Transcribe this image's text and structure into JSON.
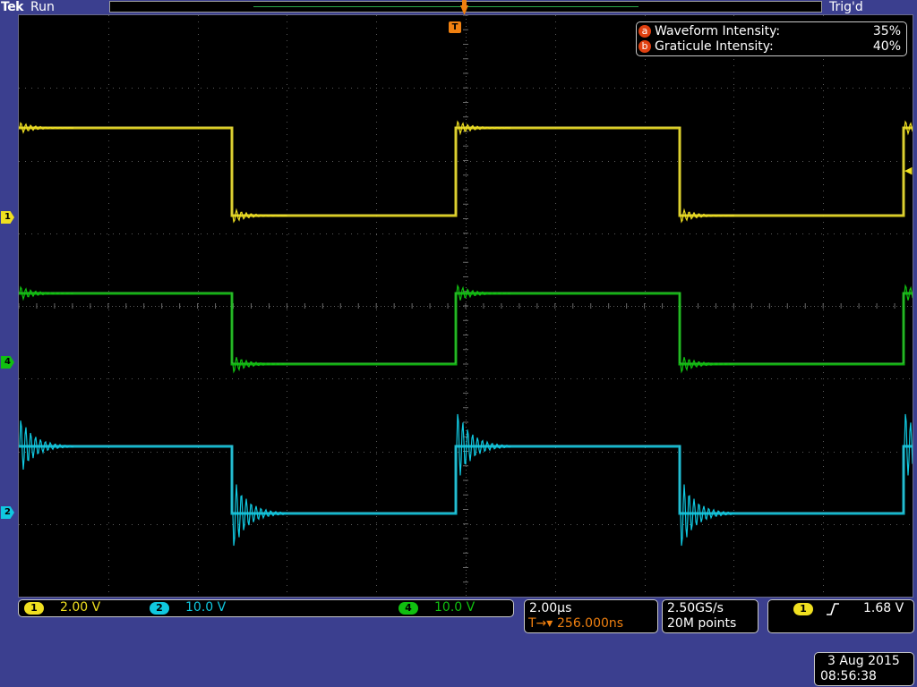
{
  "header": {
    "brand": "Tek",
    "status": "Run",
    "trigger_state": "Trig'd"
  },
  "intensity": {
    "waveform": {
      "key": "a",
      "label": "Waveform Intensity:",
      "value": "35%"
    },
    "graticule": {
      "key": "b",
      "label": "Graticule Intensity:",
      "value": "40%"
    }
  },
  "channel_markers": [
    {
      "id": "1",
      "color": "#f0e020"
    },
    {
      "id": "4",
      "color": "#10c010"
    },
    {
      "id": "2",
      "color": "#10c8e0"
    }
  ],
  "trigger_marker": "T",
  "channels_bar": {
    "ch1": {
      "id": "1",
      "scale": "2.00 V",
      "color": "#f0e020"
    },
    "ch2": {
      "id": "2",
      "scale": "10.0 V",
      "color": "#10c8e0"
    },
    "ch4": {
      "id": "4",
      "scale": "10.0 V",
      "color": "#10c010"
    }
  },
  "timebase": {
    "scale": "2.00µs",
    "position": "256.000ns",
    "position_marker": "T→▾"
  },
  "acquisition": {
    "sample_rate": "2.50GS/s",
    "record_length": "20M points"
  },
  "trigger": {
    "source": "1",
    "slope_icon": "rising-edge-icon",
    "level": "1.68 V"
  },
  "datetime": {
    "date": "3 Aug 2015",
    "time": "08:56:38"
  },
  "colors": {
    "ch1": "#f0e020",
    "ch2": "#10c8e0",
    "ch4": "#10c010",
    "trigger": "#f08010"
  }
}
